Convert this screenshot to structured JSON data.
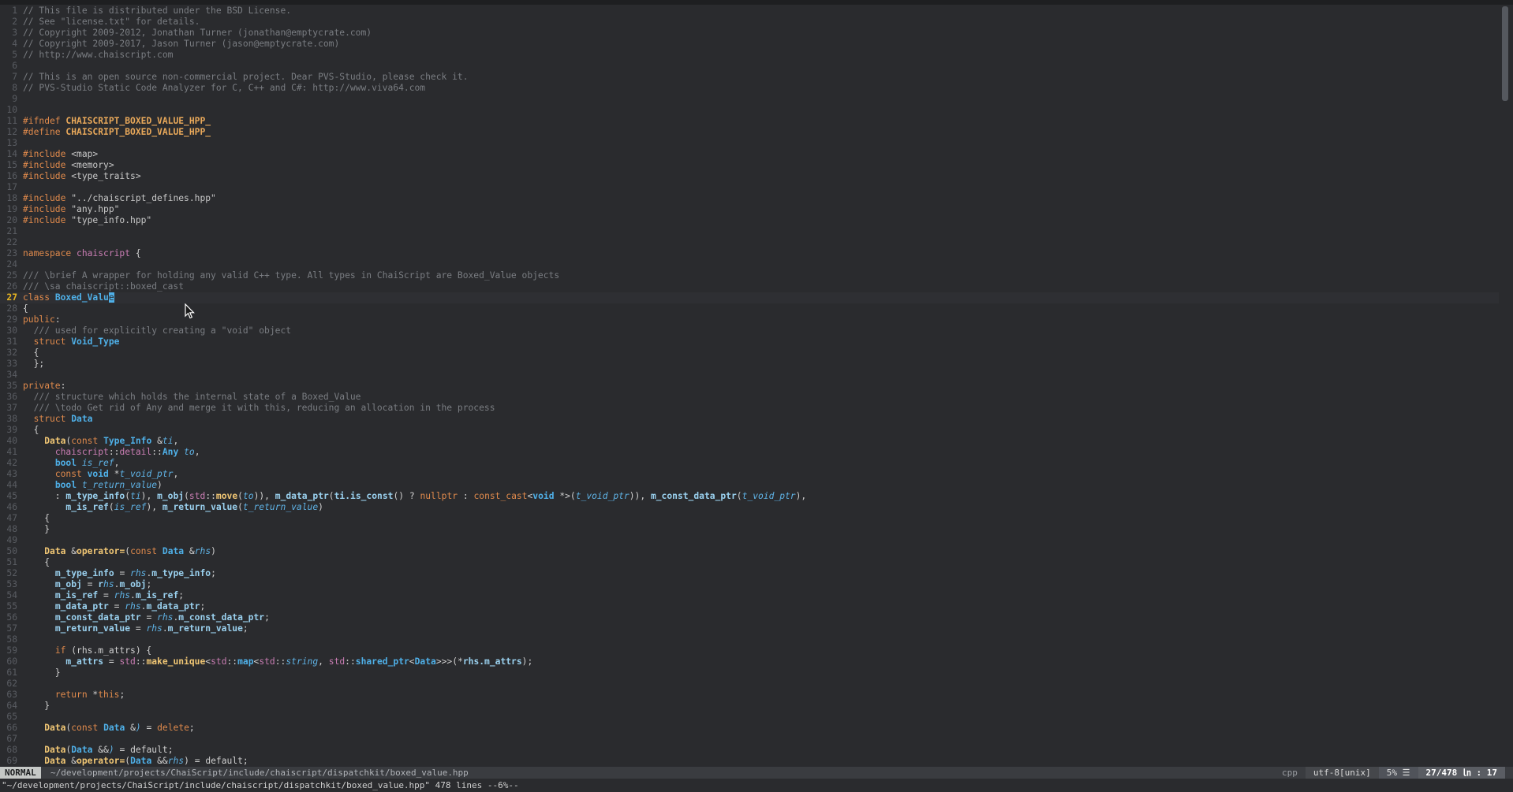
{
  "editor": {
    "mode": "NORMAL",
    "file_path": "~/development/projects/ChaiScript/include/chaiscript/dispatchkit/boxed_value.hpp",
    "filetype": "cpp",
    "encoding": "utf-8[unix]",
    "percent": "5% ☰",
    "position": "27/478 ㏑ : 17",
    "command_line": "\"~/development/projects/ChaiScript/include/chaiscript/dispatchkit/boxed_value.hpp\" 478 lines --6%--",
    "cursor_line": 27
  },
  "lines": [
    [
      [
        "cc",
        "// This file is distributed under the BSD License."
      ]
    ],
    [
      [
        "cc",
        "// See \"license.txt\" for details."
      ]
    ],
    [
      [
        "cc",
        "// Copyright 2009-2012, Jonathan Turner (jonathan@emptycrate.com)"
      ]
    ],
    [
      [
        "cc",
        "// Copyright 2009-2017, Jason Turner (jason@emptycrate.com)"
      ]
    ],
    [
      [
        "cc",
        "// http://www.chaiscript.com"
      ]
    ],
    [],
    [
      [
        "cc",
        "// This is an open source non-commercial project. Dear PVS-Studio, please check it."
      ]
    ],
    [
      [
        "cc",
        "// PVS-Studio Static Code Analyzer for C, C++ and C#: http://www.viva64.com"
      ]
    ],
    [],
    [],
    [
      [
        "pp",
        "#ifndef "
      ],
      [
        "ppn",
        "CHAISCRIPT_BOXED_VALUE_HPP_"
      ]
    ],
    [
      [
        "pp",
        "#define "
      ],
      [
        "ppn",
        "CHAISCRIPT_BOXED_VALUE_HPP_"
      ]
    ],
    [],
    [
      [
        "pp",
        "#include "
      ],
      [
        "st",
        "<map>"
      ]
    ],
    [
      [
        "pp",
        "#include "
      ],
      [
        "st",
        "<memory>"
      ]
    ],
    [
      [
        "pp",
        "#include "
      ],
      [
        "st",
        "<type_traits>"
      ]
    ],
    [],
    [
      [
        "pp",
        "#include "
      ],
      [
        "st",
        "\"../chaiscript_defines.hpp\""
      ]
    ],
    [
      [
        "pp",
        "#include "
      ],
      [
        "st",
        "\"any.hpp\""
      ]
    ],
    [
      [
        "pp",
        "#include "
      ],
      [
        "st",
        "\"type_info.hpp\""
      ]
    ],
    [],
    [],
    [
      [
        "kw",
        "namespace "
      ],
      [
        "ns",
        "chaiscript"
      ],
      [
        "tx",
        " {"
      ]
    ],
    [],
    [
      [
        "cc",
        "/// \\brief A wrapper for holding any valid C++ type. All types in ChaiScript are Boxed_Value objects"
      ]
    ],
    [
      [
        "cc",
        "/// \\sa chaiscript::boxed_cast"
      ]
    ],
    [
      [
        "kw",
        "class "
      ],
      [
        "ty",
        "Boxed_Valu"
      ],
      [
        "cursor",
        "e"
      ]
    ],
    [
      [
        "tx",
        "{"
      ]
    ],
    [
      [
        "kw",
        "public"
      ],
      [
        "tx",
        ":"
      ]
    ],
    [
      [
        "cc",
        "  /// used for explicitly creating a \"void\" object"
      ]
    ],
    [
      [
        "tx",
        "  "
      ],
      [
        "kw",
        "struct "
      ],
      [
        "ty",
        "Void_Type"
      ]
    ],
    [
      [
        "tx",
        "  {"
      ]
    ],
    [
      [
        "tx",
        "  };"
      ]
    ],
    [],
    [
      [
        "kw",
        "private"
      ],
      [
        "tx",
        ":"
      ]
    ],
    [
      [
        "cc",
        "  /// structure which holds the internal state of a Boxed_Value"
      ]
    ],
    [
      [
        "cc",
        "  /// \\todo Get rid of Any and merge it with this, reducing an allocation in the process"
      ]
    ],
    [
      [
        "tx",
        "  "
      ],
      [
        "kw",
        "struct "
      ],
      [
        "ty",
        "Data"
      ]
    ],
    [
      [
        "tx",
        "  {"
      ]
    ],
    [
      [
        "tx",
        "    "
      ],
      [
        "fn",
        "Data"
      ],
      [
        "tx",
        "("
      ],
      [
        "kw",
        "const "
      ],
      [
        "ty",
        "Type_Info "
      ],
      [
        "tx",
        "&"
      ],
      [
        "pa",
        "ti"
      ],
      [
        "tx",
        ","
      ]
    ],
    [
      [
        "tx",
        "      "
      ],
      [
        "ns",
        "chaiscript"
      ],
      [
        "tx",
        "::"
      ],
      [
        "ns",
        "detail"
      ],
      [
        "tx",
        "::"
      ],
      [
        "ty",
        "Any "
      ],
      [
        "pa",
        "to"
      ],
      [
        "tx",
        ","
      ]
    ],
    [
      [
        "tx",
        "      "
      ],
      [
        "ty",
        "bool "
      ],
      [
        "pa",
        "is_ref"
      ],
      [
        "tx",
        ","
      ]
    ],
    [
      [
        "tx",
        "      "
      ],
      [
        "kw",
        "const "
      ],
      [
        "ty",
        "void "
      ],
      [
        "tx",
        "*"
      ],
      [
        "pa",
        "t_void_ptr"
      ],
      [
        "tx",
        ","
      ]
    ],
    [
      [
        "tx",
        "      "
      ],
      [
        "ty",
        "bool "
      ],
      [
        "pa",
        "t_return_value"
      ],
      [
        "tx",
        ")"
      ]
    ],
    [
      [
        "tx",
        "      : "
      ],
      [
        "id",
        "m_type_info"
      ],
      [
        "tx",
        "("
      ],
      [
        "pa",
        "ti"
      ],
      [
        "tx",
        "), "
      ],
      [
        "id",
        "m_obj"
      ],
      [
        "tx",
        "("
      ],
      [
        "ns",
        "std"
      ],
      [
        "tx",
        "::"
      ],
      [
        "fn",
        "move"
      ],
      [
        "tx",
        "("
      ],
      [
        "pa",
        "to"
      ],
      [
        "tx",
        ")), "
      ],
      [
        "id",
        "m_data_ptr"
      ],
      [
        "tx",
        "("
      ],
      [
        "id",
        "ti.is_const"
      ],
      [
        "tx",
        "() ? "
      ],
      [
        "kw",
        "nullptr"
      ],
      [
        "tx",
        " : "
      ],
      [
        "kw",
        "const_cast"
      ],
      [
        "tx",
        "<"
      ],
      [
        "ty",
        "void "
      ],
      [
        "tx",
        "*>("
      ],
      [
        "pa",
        "t_void_ptr"
      ],
      [
        "tx",
        ")), "
      ],
      [
        "id",
        "m_const_data_ptr"
      ],
      [
        "tx",
        "("
      ],
      [
        "pa",
        "t_void_ptr"
      ],
      [
        "tx",
        "),"
      ]
    ],
    [
      [
        "tx",
        "        "
      ],
      [
        "id",
        "m_is_ref"
      ],
      [
        "tx",
        "("
      ],
      [
        "pa",
        "is_ref"
      ],
      [
        "tx",
        "), "
      ],
      [
        "id",
        "m_return_value"
      ],
      [
        "tx",
        "("
      ],
      [
        "pa",
        "t_return_value"
      ],
      [
        "tx",
        ")"
      ]
    ],
    [
      [
        "tx",
        "    {"
      ]
    ],
    [
      [
        "tx",
        "    }"
      ]
    ],
    [],
    [
      [
        "tx",
        "    "
      ],
      [
        "fn",
        "Data "
      ],
      [
        "tx",
        "&"
      ],
      [
        "fn",
        "operator="
      ],
      [
        "tx",
        "("
      ],
      [
        "kw",
        "const "
      ],
      [
        "ty",
        "Data "
      ],
      [
        "tx",
        "&"
      ],
      [
        "pa",
        "rhs"
      ],
      [
        "tx",
        ")"
      ]
    ],
    [
      [
        "tx",
        "    {"
      ]
    ],
    [
      [
        "tx",
        "      "
      ],
      [
        "id",
        "m_type_info"
      ],
      [
        "tx",
        " = "
      ],
      [
        "pa",
        "rhs"
      ],
      [
        "tx",
        "."
      ],
      [
        "id",
        "m_type_info"
      ],
      [
        "tx",
        ";"
      ]
    ],
    [
      [
        "tx",
        "      "
      ],
      [
        "id",
        "m_obj"
      ],
      [
        "tx",
        " = "
      ],
      [
        "id",
        "r"
      ],
      [
        "pa",
        "hs"
      ],
      [
        "tx",
        "."
      ],
      [
        "id",
        "m_obj"
      ],
      [
        "tx",
        ";"
      ]
    ],
    [
      [
        "tx",
        "      "
      ],
      [
        "id",
        "m_is_ref"
      ],
      [
        "tx",
        " = "
      ],
      [
        "pa",
        "rhs"
      ],
      [
        "tx",
        "."
      ],
      [
        "id",
        "m_is_ref"
      ],
      [
        "tx",
        ";"
      ]
    ],
    [
      [
        "tx",
        "      "
      ],
      [
        "id",
        "m_data_ptr"
      ],
      [
        "tx",
        " = "
      ],
      [
        "pa",
        "rhs"
      ],
      [
        "tx",
        "."
      ],
      [
        "id",
        "m_data_ptr"
      ],
      [
        "tx",
        ";"
      ]
    ],
    [
      [
        "tx",
        "      "
      ],
      [
        "id",
        "m_const_data_ptr"
      ],
      [
        "tx",
        " = "
      ],
      [
        "pa",
        "rhs"
      ],
      [
        "tx",
        "."
      ],
      [
        "id",
        "m_const_data_ptr"
      ],
      [
        "tx",
        ";"
      ]
    ],
    [
      [
        "tx",
        "      "
      ],
      [
        "id",
        "m_return_value"
      ],
      [
        "tx",
        " = "
      ],
      [
        "pa",
        "rhs"
      ],
      [
        "tx",
        "."
      ],
      [
        "id",
        "m_return_value"
      ],
      [
        "tx",
        ";"
      ]
    ],
    [],
    [
      [
        "tx",
        "      "
      ],
      [
        "kw",
        "if "
      ],
      [
        "tx",
        "(rhs.m_attrs) {"
      ]
    ],
    [
      [
        "tx",
        "        "
      ],
      [
        "id",
        "m_attrs"
      ],
      [
        "tx",
        " = "
      ],
      [
        "ns",
        "std"
      ],
      [
        "tx",
        "::"
      ],
      [
        "fn",
        "make_unique"
      ],
      [
        "tx",
        "<"
      ],
      [
        "ns",
        "std"
      ],
      [
        "tx",
        "::"
      ],
      [
        "ty",
        "map"
      ],
      [
        "tx",
        "<"
      ],
      [
        "ns",
        "std"
      ],
      [
        "tx",
        "::"
      ],
      [
        "pa",
        "string"
      ],
      [
        "tx",
        ", "
      ],
      [
        "ns",
        "std"
      ],
      [
        "tx",
        "::"
      ],
      [
        "ty",
        "shared_ptr"
      ],
      [
        "tx",
        "<"
      ],
      [
        "ty",
        "Data"
      ],
      [
        "tx",
        ">>>(*"
      ],
      [
        "id",
        "rhs.m_attrs"
      ],
      [
        "tx",
        ");"
      ]
    ],
    [
      [
        "tx",
        "      }"
      ]
    ],
    [],
    [
      [
        "tx",
        "      "
      ],
      [
        "kw",
        "return "
      ],
      [
        "tx",
        "*"
      ],
      [
        "kw",
        "this"
      ],
      [
        "tx",
        ";"
      ]
    ],
    [
      [
        "tx",
        "    }"
      ]
    ],
    [],
    [
      [
        "tx",
        "    "
      ],
      [
        "fn",
        "Data"
      ],
      [
        "tx",
        "("
      ],
      [
        "kw",
        "const "
      ],
      [
        "ty",
        "Data "
      ],
      [
        "tx",
        "&"
      ],
      [
        "pa",
        ")"
      ],
      [
        "tx",
        " = "
      ],
      [
        "kw",
        "delete"
      ],
      [
        "tx",
        ";"
      ]
    ],
    [],
    [
      [
        "tx",
        "    "
      ],
      [
        "fn",
        "Data"
      ],
      [
        "tx",
        "("
      ],
      [
        "ty",
        "Data "
      ],
      [
        "tx",
        "&&"
      ],
      [
        "pa",
        ")"
      ],
      [
        "tx",
        " = "
      ],
      [
        "tx",
        "default;"
      ]
    ],
    [
      [
        "tx",
        "    "
      ],
      [
        "fn",
        "Data "
      ],
      [
        "tx",
        "&"
      ],
      [
        "fn",
        "operator="
      ],
      [
        "tx",
        "("
      ],
      [
        "ty",
        "Data "
      ],
      [
        "tx",
        "&&"
      ],
      [
        "pa",
        "rhs"
      ],
      [
        "tx",
        ") = default;"
      ]
    ]
  ]
}
